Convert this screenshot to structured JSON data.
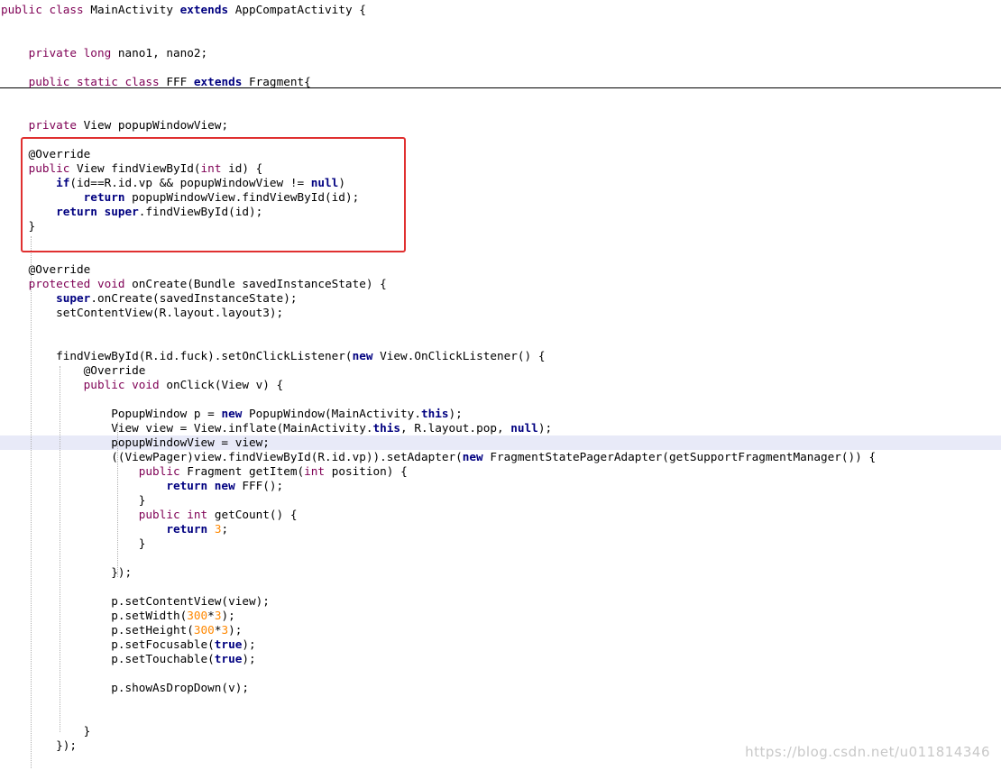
{
  "editor": {
    "lines": [
      [
        {
          "t": "public class ",
          "c": "kw2"
        },
        {
          "t": "MainActivity "
        },
        {
          "t": "extends ",
          "c": "kw"
        },
        {
          "t": "AppCompatActivity {"
        }
      ],
      [],
      [],
      [
        {
          "t": "    "
        },
        {
          "t": "private long ",
          "c": "kw2"
        },
        {
          "t": "nano1, nano2;"
        }
      ],
      [],
      [
        {
          "t": "    "
        },
        {
          "t": "public static class ",
          "c": "kw2"
        },
        {
          "t": "FFF "
        },
        {
          "t": "extends ",
          "c": "kw"
        },
        {
          "t": "Fragment{"
        }
      ],
      [],
      [],
      [
        {
          "t": "    "
        },
        {
          "t": "private ",
          "c": "kw2"
        },
        {
          "t": "View popupWindowView;"
        }
      ],
      [],
      [
        {
          "t": "    @Override",
          "c": "ann"
        }
      ],
      [
        {
          "t": "    "
        },
        {
          "t": "public ",
          "c": "kw2"
        },
        {
          "t": "View findViewById("
        },
        {
          "t": "int ",
          "c": "kw2"
        },
        {
          "t": "id) {"
        }
      ],
      [
        {
          "t": "        "
        },
        {
          "t": "if",
          "c": "kw"
        },
        {
          "t": "(id==R.id.vp && popupWindowView != "
        },
        {
          "t": "null",
          "c": "kw"
        },
        {
          "t": ")"
        }
      ],
      [
        {
          "t": "            "
        },
        {
          "t": "return ",
          "c": "kw"
        },
        {
          "t": "popupWindowView.findViewById(id);"
        }
      ],
      [
        {
          "t": "        "
        },
        {
          "t": "return super",
          "c": "kw"
        },
        {
          "t": ".findViewById(id);"
        }
      ],
      [
        {
          "t": "    }"
        }
      ],
      [],
      [],
      [
        {
          "t": "    @Override",
          "c": "ann"
        }
      ],
      [
        {
          "t": "    "
        },
        {
          "t": "protected void ",
          "c": "kw2"
        },
        {
          "t": "onCreate(Bundle savedInstanceState) {"
        }
      ],
      [
        {
          "t": "        "
        },
        {
          "t": "super",
          "c": "kw"
        },
        {
          "t": ".onCreate(savedInstanceState);"
        }
      ],
      [
        {
          "t": "        setContentView(R.layout.layout3);"
        }
      ],
      [],
      [],
      [
        {
          "t": "        findViewById(R.id.fuck).setOnClickListener("
        },
        {
          "t": "new ",
          "c": "kw"
        },
        {
          "t": "View.OnClickListener() {"
        }
      ],
      [
        {
          "t": "            @Override",
          "c": "ann"
        }
      ],
      [
        {
          "t": "            "
        },
        {
          "t": "public void ",
          "c": "kw2"
        },
        {
          "t": "onClick(View v) {"
        }
      ],
      [],
      [
        {
          "t": "                PopupWindow p = "
        },
        {
          "t": "new ",
          "c": "kw"
        },
        {
          "t": "PopupWindow(MainActivity."
        },
        {
          "t": "this",
          "c": "kw"
        },
        {
          "t": ");"
        }
      ],
      [
        {
          "t": "                View view = View.inflate(MainActivity."
        },
        {
          "t": "this",
          "c": "kw"
        },
        {
          "t": ", R.layout.pop, "
        },
        {
          "t": "null",
          "c": "kw"
        },
        {
          "t": ");"
        }
      ],
      [
        {
          "t": "                popupWindowView = view;"
        }
      ],
      [
        {
          "t": "                ((ViewPager)view.findViewById(R.id.vp)).setAdapter("
        },
        {
          "t": "new ",
          "c": "kw"
        },
        {
          "t": "FragmentStatePagerAdapter(getSupportFragmentManager()) {"
        }
      ],
      [
        {
          "t": "                    "
        },
        {
          "t": "public ",
          "c": "kw2"
        },
        {
          "t": "Fragment getItem("
        },
        {
          "t": "int ",
          "c": "kw2"
        },
        {
          "t": "position) {"
        }
      ],
      [
        {
          "t": "                        "
        },
        {
          "t": "return new ",
          "c": "kw"
        },
        {
          "t": "FFF();"
        }
      ],
      [
        {
          "t": "                    }"
        }
      ],
      [
        {
          "t": "                    "
        },
        {
          "t": "public int ",
          "c": "kw2"
        },
        {
          "t": "getCount() {"
        }
      ],
      [
        {
          "t": "                        "
        },
        {
          "t": "return ",
          "c": "kw"
        },
        {
          "t": "3",
          "c": "num"
        },
        {
          "t": ";"
        }
      ],
      [
        {
          "t": "                    }"
        }
      ],
      [],
      [
        {
          "t": "                });"
        }
      ],
      [],
      [
        {
          "t": "                p.setContentView(view);"
        }
      ],
      [
        {
          "t": "                p.setWidth("
        },
        {
          "t": "300",
          "c": "num"
        },
        {
          "t": "*"
        },
        {
          "t": "3",
          "c": "num"
        },
        {
          "t": ");"
        }
      ],
      [
        {
          "t": "                p.setHeight("
        },
        {
          "t": "300",
          "c": "num"
        },
        {
          "t": "*"
        },
        {
          "t": "3",
          "c": "num"
        },
        {
          "t": ");"
        }
      ],
      [
        {
          "t": "                p.setFocusable("
        },
        {
          "t": "true",
          "c": "kw"
        },
        {
          "t": ");"
        }
      ],
      [
        {
          "t": "                p.setTouchable("
        },
        {
          "t": "true",
          "c": "kw"
        },
        {
          "t": ");"
        }
      ],
      [],
      [
        {
          "t": "                p.showAsDropDown(v);"
        }
      ],
      [],
      [],
      [
        {
          "t": "            }"
        }
      ],
      [
        {
          "t": "        });"
        }
      ]
    ]
  },
  "watermark": "https://blog.csdn.net/u011814346",
  "colors": {
    "keyword": "#000080",
    "keyword2": "#7f0055",
    "number": "#ff8800",
    "highlight_box": "#e03030",
    "current_line": "#e8eaf8"
  }
}
